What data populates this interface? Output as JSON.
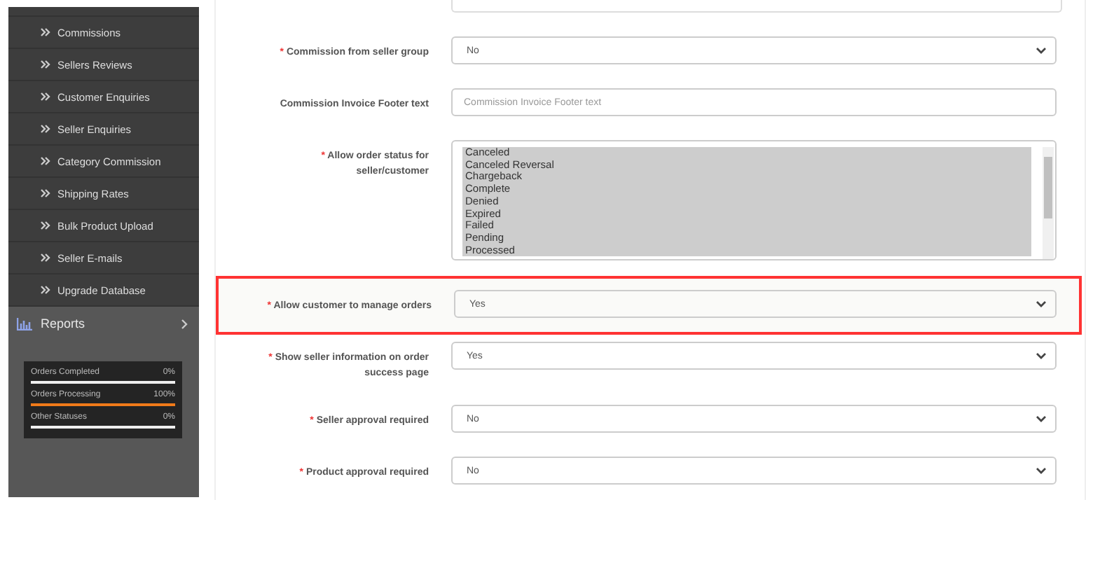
{
  "sidebar": {
    "items": [
      {
        "label": "Commissions"
      },
      {
        "label": "Sellers Reviews"
      },
      {
        "label": "Customer Enquiries"
      },
      {
        "label": "Seller Enquiries"
      },
      {
        "label": "Category Commission"
      },
      {
        "label": "Shipping Rates"
      },
      {
        "label": "Bulk Product Upload"
      },
      {
        "label": "Seller E-mails"
      },
      {
        "label": "Upgrade Database"
      }
    ],
    "section": {
      "label": "Reports",
      "expanded": false
    },
    "stats": [
      {
        "label": "Orders Completed",
        "value": "0%",
        "level": 0
      },
      {
        "label": "Orders Processing",
        "value": "100%",
        "level": 1
      },
      {
        "label": "Other Statuses",
        "value": "0%",
        "level": 0
      }
    ]
  },
  "form": {
    "rows": [
      {
        "kind": "select",
        "required_mark": "*",
        "label": "Commission from seller group",
        "value": "No",
        "highlighted": false
      },
      {
        "kind": "text",
        "label": "Commission Invoice Footer text",
        "placeholder": "Commission Invoice Footer text",
        "highlighted": false
      },
      {
        "kind": "listbox",
        "required_mark": "*",
        "label": "Allow order status for seller/customer",
        "highlighted": false,
        "options": [
          {
            "label": "Canceled",
            "selected": true
          },
          {
            "label": "Canceled Reversal",
            "selected": true
          },
          {
            "label": "Chargeback",
            "selected": true
          },
          {
            "label": "Complete",
            "selected": true
          },
          {
            "label": "Denied",
            "selected": true
          },
          {
            "label": "Expired",
            "selected": true
          },
          {
            "label": "Failed",
            "selected": true
          },
          {
            "label": "Pending",
            "selected": true
          },
          {
            "label": "Processed",
            "selected": true
          }
        ]
      },
      {
        "kind": "select",
        "required_mark": "*",
        "label": "Allow customer to manage orders",
        "value": "Yes",
        "highlighted": true
      },
      {
        "kind": "select",
        "required_mark": "*",
        "label": "Show seller information on order success page",
        "value": "Yes",
        "highlighted": false
      },
      {
        "kind": "select",
        "required_mark": "*",
        "label": "Seller approval required",
        "value": "No",
        "highlighted": false
      },
      {
        "kind": "select",
        "required_mark": "*",
        "label": "Product approval required",
        "value": "No",
        "highlighted": false
      }
    ]
  }
}
